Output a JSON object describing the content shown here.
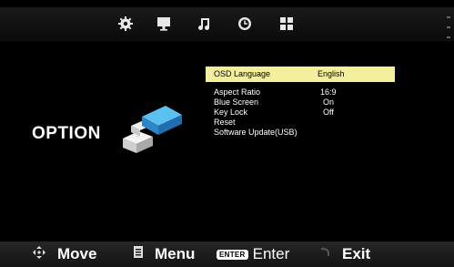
{
  "tabs": [
    {
      "icon": "gear-icon"
    },
    {
      "icon": "monitor-icon"
    },
    {
      "icon": "music-note-icon"
    },
    {
      "icon": "clock-icon"
    },
    {
      "icon": "grid-icon"
    }
  ],
  "section": {
    "title": "OPTION"
  },
  "menu": {
    "items": [
      {
        "label": "OSD Language",
        "value": "English",
        "selected": true
      },
      {
        "label": "Aspect Ratio",
        "value": "16:9"
      },
      {
        "label": "Blue Screen",
        "value": "On"
      },
      {
        "label": "Key Lock",
        "value": "Off"
      },
      {
        "label": "Reset",
        "value": ""
      },
      {
        "label": "Software Update(USB)",
        "value": ""
      }
    ]
  },
  "hints": {
    "move": "Move",
    "menu": "Menu",
    "enter_badge": "ENTER",
    "enter": "Enter",
    "exit": "Exit"
  },
  "colors": {
    "highlight": "#f2f09c",
    "background": "#000000",
    "graphic_blue": "#3aa3e0"
  }
}
